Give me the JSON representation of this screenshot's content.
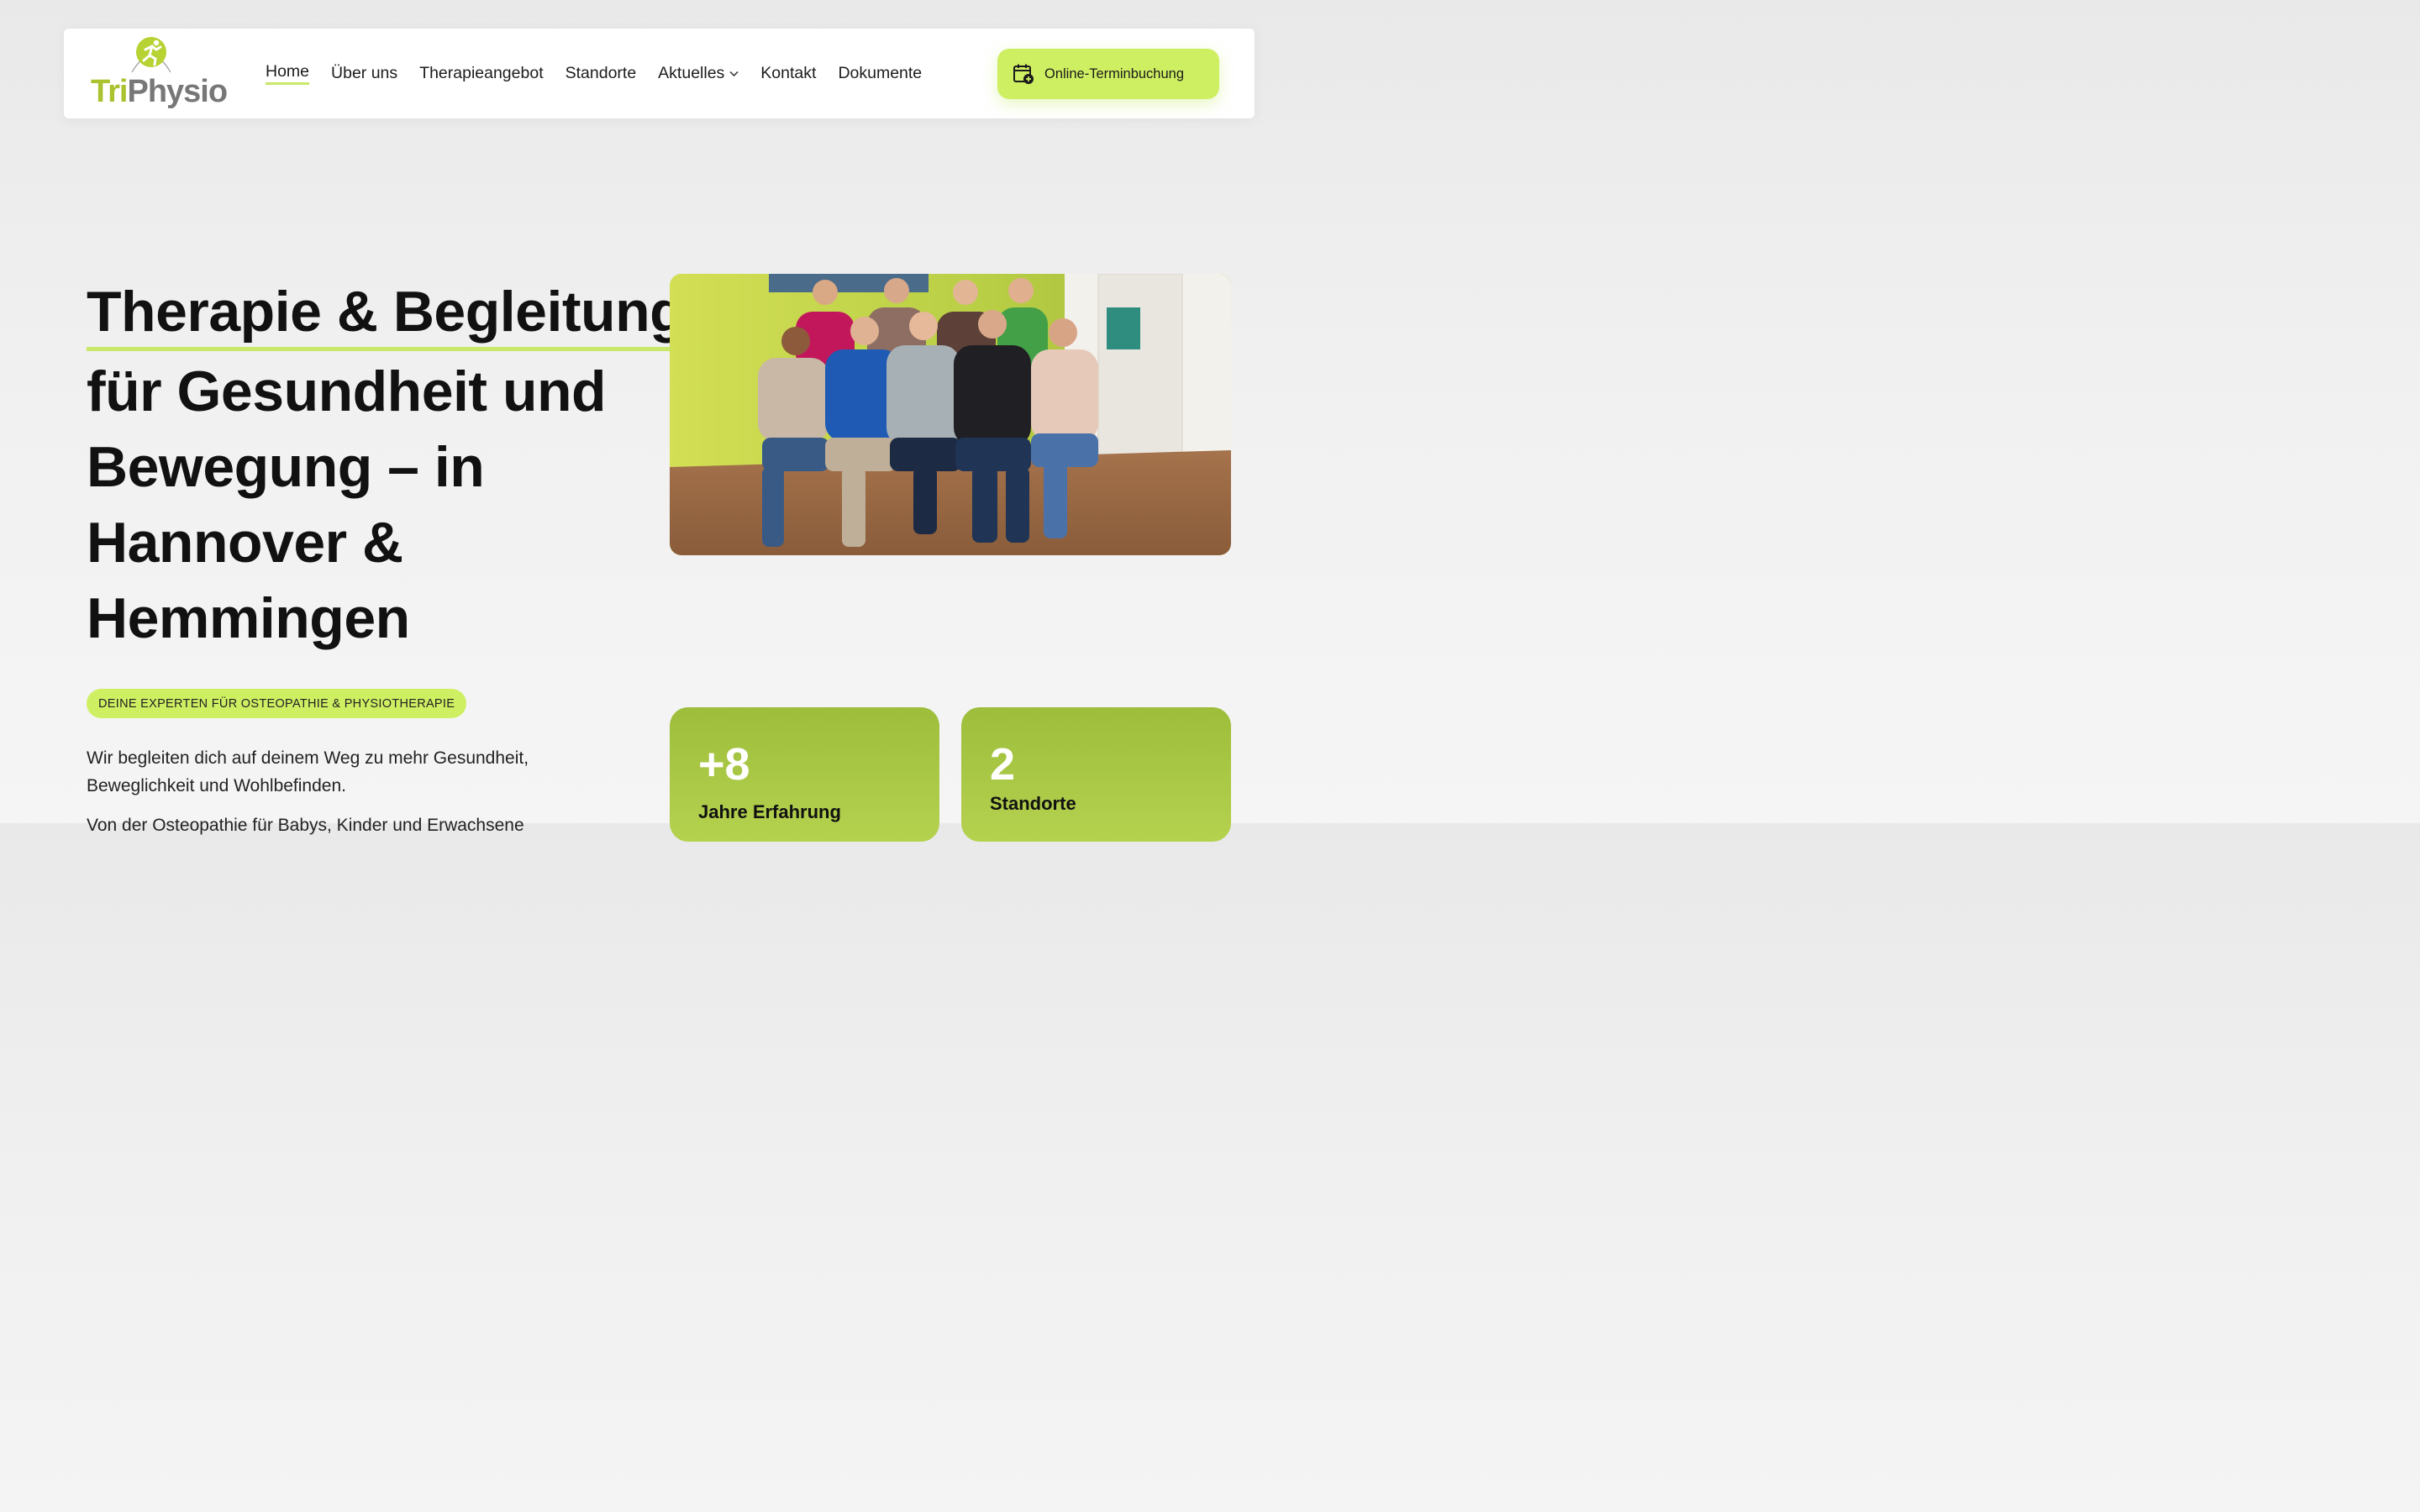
{
  "header": {
    "logo": {
      "part1": "Tri",
      "part2": "Physio"
    },
    "nav": [
      {
        "label": "Home",
        "active": true
      },
      {
        "label": "Über uns"
      },
      {
        "label": "Therapieangebot"
      },
      {
        "label": "Standorte"
      },
      {
        "label": "Aktuelles",
        "has_dropdown": true
      },
      {
        "label": "Kontakt"
      },
      {
        "label": "Dokumente"
      }
    ],
    "cta_label": "Online-Terminbuchung",
    "cta_icon": "calendar-plus-icon"
  },
  "hero": {
    "headline_lines": [
      "Therapie & Begleitung",
      "für Gesundheit und",
      "Bewegung – in",
      "Hannover &",
      "Hemmingen"
    ],
    "badge": "DEINE EXPERTEN FÜR OSTEOPATHIE & PHYSIOTHERAPIE",
    "intro": "Wir begleiten dich auf deinem Weg zu mehr Gesundheit, Beweglichkeit und Wohlbefinden.",
    "intro2": "Von der Osteopathie für Babys, Kinder und Erwachsene"
  },
  "stats": [
    {
      "value": "+8",
      "label": "Jahre Erfahrung"
    },
    {
      "value": "2",
      "label": "Standorte"
    }
  ],
  "colors": {
    "accent": "#cfef63",
    "underline": "#c9e86a",
    "card_green": "#a8c443",
    "logo_green": "#a9c22e"
  }
}
